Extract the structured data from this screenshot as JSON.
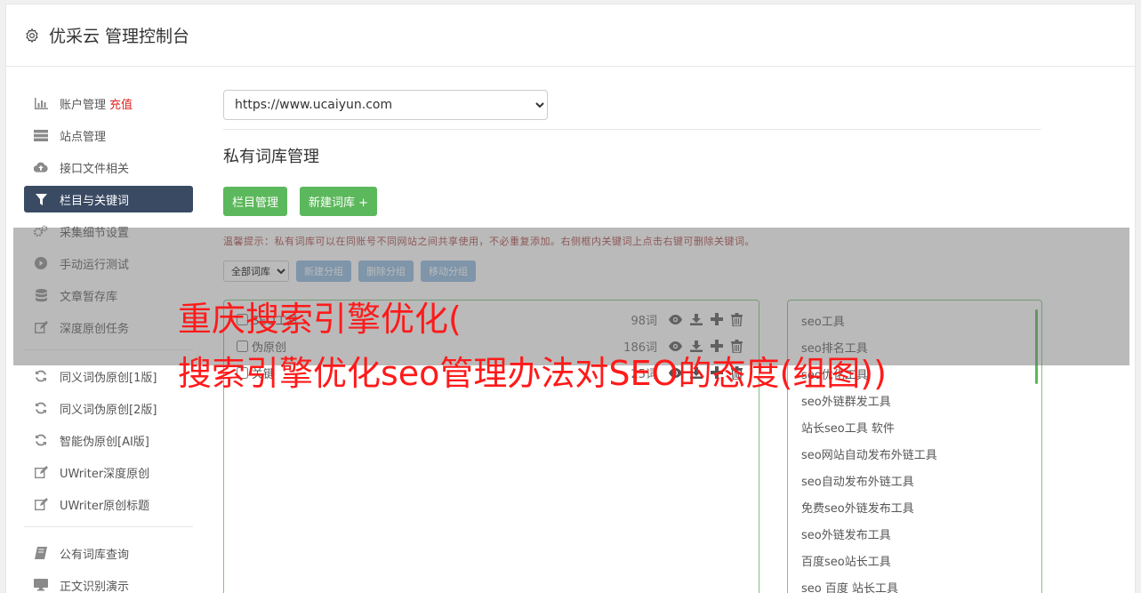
{
  "header": {
    "title": "优采云 管理控制台"
  },
  "sidebar": {
    "items": [
      {
        "label": "账户管理",
        "icon": "bar-chart-icon",
        "badge": "充值"
      },
      {
        "label": "站点管理",
        "icon": "server-icon"
      },
      {
        "label": "接口文件相关",
        "icon": "cloud-upload-icon"
      },
      {
        "label": "栏目与关键词",
        "icon": "filter-icon",
        "active": true
      },
      {
        "label": "采集细节设置",
        "icon": "cogs-icon"
      },
      {
        "label": "手动运行测试",
        "icon": "play-circle-icon"
      },
      {
        "label": "文章暂存库",
        "icon": "database-icon"
      },
      {
        "label": "深度原创任务",
        "icon": "edit-icon"
      }
    ],
    "items2": [
      {
        "label": "同义词伪原创[1版]",
        "icon": "refresh-icon"
      },
      {
        "label": "同义词伪原创[2版]",
        "icon": "refresh-icon"
      },
      {
        "label": "智能伪原创[AI版]",
        "icon": "refresh-icon"
      },
      {
        "label": "UWriter深度原创",
        "icon": "edit-icon"
      },
      {
        "label": "UWriter原创标题",
        "icon": "edit-icon"
      }
    ],
    "items3": [
      {
        "label": "公有词库查询",
        "icon": "book-icon"
      },
      {
        "label": "正文识别演示",
        "icon": "monitor-icon"
      }
    ]
  },
  "main": {
    "site_select": "https://www.ucaiyun.com",
    "section_title": "私有词库管理",
    "btn_column_manage": "栏目管理",
    "btn_new_library": "新建词库 +",
    "tip": "温馨提示：私有词库可以在同账号不同网站之间共享使用，不必重复添加。右侧框内关键词上点击右键可删除关键词。",
    "group_select": "全部词库",
    "btn_new_group": "新建分组",
    "btn_delete_group": "删除分组",
    "btn_move_group": "移动分组",
    "libraries": [
      {
        "name": "SEO工具",
        "count": "98词"
      },
      {
        "name": "伪原创",
        "count": "186词"
      },
      {
        "name": "关键",
        "count": "25词"
      }
    ],
    "keywords": [
      "seo工具",
      "seo排名工具",
      "seo优化工具",
      "seo外链群发工具",
      "站长seo工具 软件",
      "seo网站自动发布外链工具",
      "seo自动发布外链工具",
      "免费seo外链发布工具",
      "seo外链发布工具",
      "百度seo站长工具",
      "seo 百度 站长工具"
    ]
  },
  "overlay": {
    "line1": "重庆搜索引擎优化(",
    "line2": "搜索引擎优化seo管理办法对SEO的态度(组图))"
  }
}
